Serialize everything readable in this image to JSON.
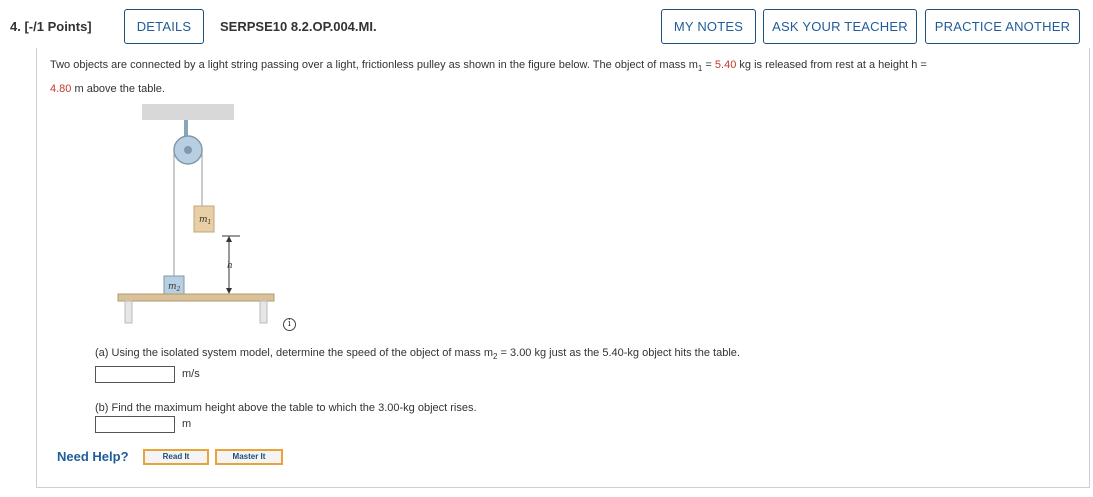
{
  "header": {
    "question_number": "4.",
    "points": "[-/1 Points]",
    "details_label": "DETAILS",
    "problem_code": "SERPSE10 8.2.OP.004.MI.",
    "my_notes_label": "MY NOTES",
    "ask_teacher_label": "ASK YOUR TEACHER",
    "practice_another_label": "PRACTICE ANOTHER"
  },
  "problem": {
    "text_before_m1": "Two objects are connected by a light string passing over a light, frictionless pulley as shown in the figure below. The object of mass m",
    "m1_subscript": "1",
    "equals": " = ",
    "m1_value": "5.40",
    "text_after_m1": " kg is released from rest at a height h =",
    "h_value": "4.80",
    "text_after_h": " m above the table."
  },
  "figure": {
    "m1_label": "m",
    "m1_sub": "1",
    "m2_label": "m",
    "m2_sub": "2",
    "h_label": "h",
    "info_icon": "i"
  },
  "part_a": {
    "prefix": "(a) Using the isolated system model, determine the speed of the object of mass m",
    "subscript": "2",
    "suffix": " = 3.00 kg just as the 5.40-kg object hits the table.",
    "input_value": "",
    "unit": "m/s"
  },
  "part_b": {
    "text": "(b) Find the maximum height above the table to which the 3.00-kg object rises.",
    "input_value": "",
    "unit": "m"
  },
  "help": {
    "label": "Need Help?",
    "read_it": "Read It",
    "master_it": "Master It"
  },
  "colors": {
    "accent": "#1f5c99",
    "given_value": "#c0392b",
    "help_border": "#e8a33b"
  }
}
